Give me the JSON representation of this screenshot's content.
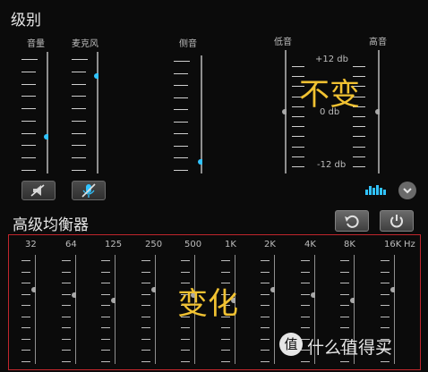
{
  "levels": {
    "title": "级别",
    "sliders": [
      {
        "label": "音量",
        "level_fraction": 0.3
      },
      {
        "label": "麦克风",
        "level_fraction": 0.8
      },
      {
        "label": "侧音",
        "level_fraction": 0.1
      }
    ],
    "buttons": [
      {
        "name": "mute-speaker-button",
        "icon": "speaker-muted-icon"
      },
      {
        "name": "mute-microphone-button",
        "icon": "microphone-muted-icon"
      }
    ]
  },
  "bass_treble": {
    "bass_label": "低音",
    "treble_label": "高音",
    "max_label": "+12 db",
    "mid_label": "0 db",
    "min_label": "-12 db",
    "bass_db": 0,
    "treble_db": 0
  },
  "eq_toggle": {
    "icon": "equalizer-icon"
  },
  "expand": {
    "icon": "chevron-down-icon"
  },
  "equalizer": {
    "title": "高级均衡器",
    "bands": [
      "32",
      "64",
      "125",
      "250",
      "500",
      "1K",
      "2K",
      "4K",
      "8K",
      "16K"
    ],
    "unit": "Hz",
    "reset_icon": "reset-icon",
    "power_icon": "power-icon"
  },
  "annotations": {
    "unchanged": "不变",
    "changed": "变化"
  },
  "watermark": {
    "logo_char": "值",
    "text": "什么值得买"
  },
  "colors": {
    "accent": "#31c3ff",
    "overlay": "#f1c232",
    "eq_border": "#c0262c"
  }
}
